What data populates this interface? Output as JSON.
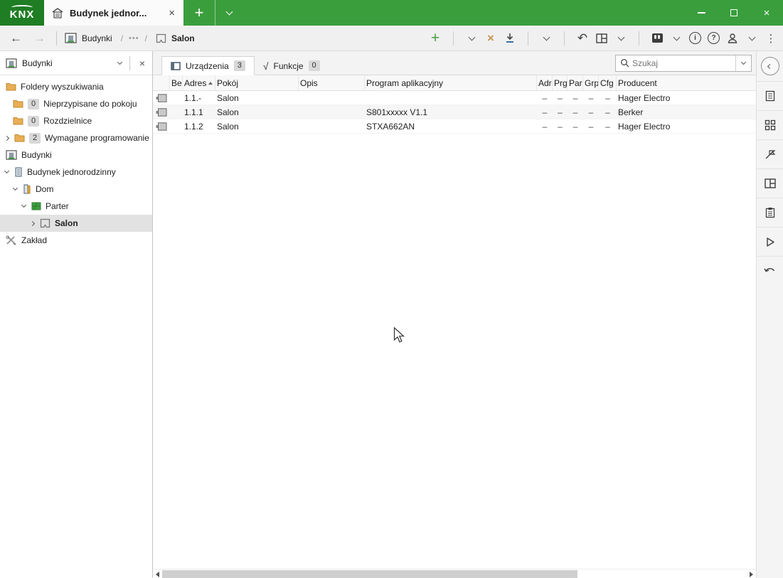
{
  "titlebar": {
    "logo_text": "KNX",
    "tab": {
      "title": "Budynek jednor...",
      "close": "×"
    },
    "new_tab": "+",
    "window_controls": {
      "close": "×"
    }
  },
  "breadcrumb": {
    "back": "←",
    "forward": "→",
    "slash": "/",
    "dots": "•••",
    "items": [
      {
        "label": "Budynki"
      },
      {
        "label": "Salon"
      }
    ]
  },
  "toolbar": {
    "add": "+",
    "delete": "×",
    "undo": "↶",
    "info": "i",
    "help": "?",
    "overflow": "⋮"
  },
  "sidebar": {
    "header": {
      "title": "Budynki",
      "close": "×"
    },
    "tree": [
      {
        "label": "Foldery wyszukiwania",
        "badge": null
      },
      {
        "label": "Nieprzypisane do pokoju",
        "badge": "0"
      },
      {
        "label": "Rozdzielnice",
        "badge": "0"
      },
      {
        "label": "Wymagane programowanie",
        "badge": "2"
      },
      {
        "label": "Budynki",
        "badge": null
      },
      {
        "label": "Budynek jednorodzinny",
        "badge": null
      },
      {
        "label": "Dom",
        "badge": null
      },
      {
        "label": "Parter",
        "badge": null
      },
      {
        "label": "Salon",
        "badge": null
      },
      {
        "label": "Zakład",
        "badge": null
      }
    ]
  },
  "main": {
    "tabs": [
      {
        "label": "Urządzenia",
        "count": "3"
      },
      {
        "label": "Funkcje",
        "count": "0",
        "glyph": "√"
      }
    ],
    "search": {
      "placeholder": "Szukaj"
    },
    "table": {
      "headers": {
        "be": "Be",
        "address": "Adres",
        "room": "Pokój",
        "description": "Opis",
        "program": "Program aplikacyjny",
        "adr": "Adr",
        "prg": "Prg",
        "par": "Par",
        "grp": "Grp",
        "cfg": "Cfg",
        "manufacturer": "Producent"
      },
      "rows": [
        {
          "address": "1.1.-",
          "room": "Salon",
          "description": "",
          "program": "",
          "adr": "–",
          "prg": "–",
          "par": "–",
          "grp": "–",
          "cfg": "–",
          "manufacturer": "Hager Electro"
        },
        {
          "address": "1.1.1",
          "room": "Salon",
          "description": "",
          "program": "S801xxxxx V1.1",
          "adr": "–",
          "prg": "–",
          "par": "–",
          "grp": "–",
          "cfg": "–",
          "manufacturer": "Berker"
        },
        {
          "address": "1.1.2",
          "room": "Salon",
          "description": "",
          "program": "STXA662AN",
          "adr": "–",
          "prg": "–",
          "par": "–",
          "grp": "–",
          "cfg": "–",
          "manufacturer": "Hager Electro"
        }
      ]
    }
  },
  "colors": {
    "brand_green": "#3a9e3d",
    "logo_green": "#1f7d24",
    "add_green": "#4a9b45",
    "delete_orange": "#c79552",
    "download_blue": "#3a6ea5",
    "selection_gray": "#e2e2e2"
  }
}
